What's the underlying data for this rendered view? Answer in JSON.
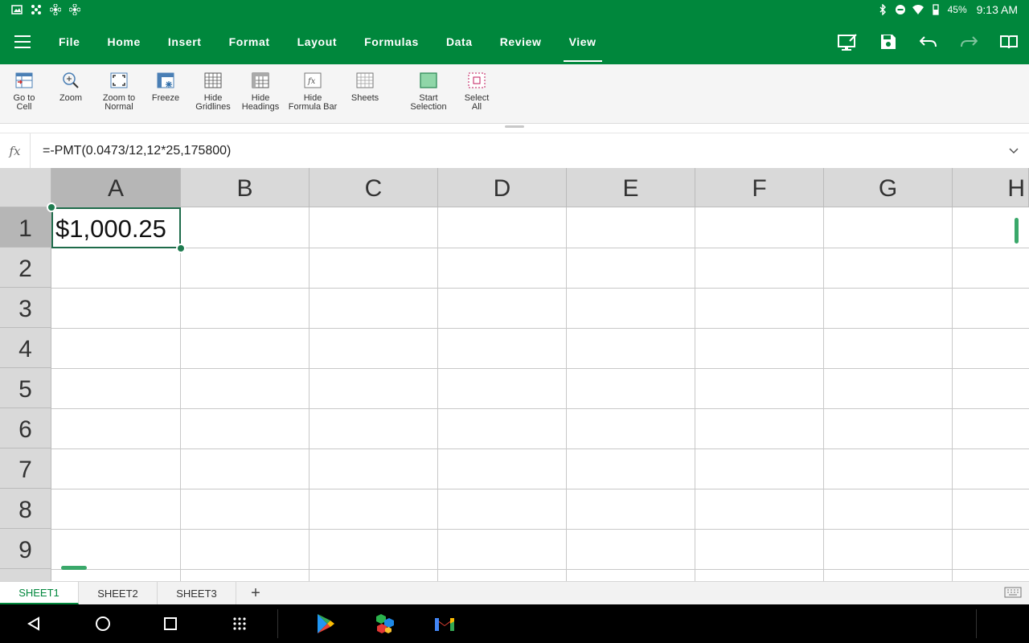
{
  "status_bar": {
    "battery": "45%",
    "time": "9:13 AM"
  },
  "app_bar": {
    "tabs": [
      {
        "label": "File"
      },
      {
        "label": "Home"
      },
      {
        "label": "Insert"
      },
      {
        "label": "Format"
      },
      {
        "label": "Layout"
      },
      {
        "label": "Formulas"
      },
      {
        "label": "Data"
      },
      {
        "label": "Review"
      },
      {
        "label": "View"
      }
    ],
    "active_tab": "View",
    "icons": [
      "menu-icon",
      "reading-mode-icon",
      "save-icon",
      "undo-icon",
      "redo-icon",
      "book-icon"
    ]
  },
  "ribbon": {
    "buttons": [
      {
        "label_1": "Go to",
        "label_2": "Cell"
      },
      {
        "label_1": "Zoom",
        "label_2": ""
      },
      {
        "label_1": "Zoom to",
        "label_2": "Normal"
      },
      {
        "label_1": "Freeze",
        "label_2": ""
      },
      {
        "label_1": "Hide",
        "label_2": "Gridlines"
      },
      {
        "label_1": "Hide",
        "label_2": "Headings"
      },
      {
        "label_1": "Hide",
        "label_2": "Formula Bar"
      },
      {
        "label_1": "Sheets",
        "label_2": ""
      },
      {
        "label_1": "Start",
        "label_2": "Selection"
      },
      {
        "label_1": "Select",
        "label_2": "All"
      }
    ]
  },
  "formula_bar": {
    "fx_label": "fx",
    "formula": "=-PMT(0.0473/12,12*25,175800)"
  },
  "grid": {
    "columns": [
      "A",
      "B",
      "C",
      "D",
      "E",
      "F",
      "G",
      "H"
    ],
    "rows": [
      "1",
      "2",
      "3",
      "4",
      "5",
      "6",
      "7",
      "8",
      "9"
    ],
    "selected_cell": "A1",
    "cell_a1_value": "$1,000.25"
  },
  "sheets": {
    "tabs": [
      "SHEET1",
      "SHEET2",
      "SHEET3"
    ],
    "active": "SHEET1",
    "add_label": "+"
  },
  "colors": {
    "brand": "#00873c",
    "selection": "#1e7b4f"
  }
}
